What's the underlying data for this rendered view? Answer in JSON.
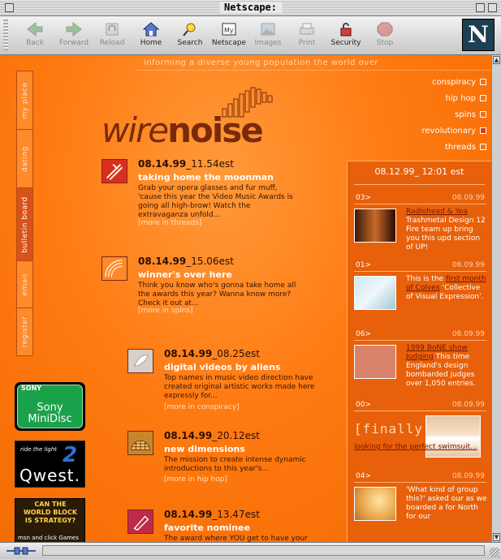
{
  "window": {
    "title": "Netscape:"
  },
  "toolbar": {
    "buttons": [
      {
        "label": "Back",
        "icon": "back-arrow-icon"
      },
      {
        "label": "Forward",
        "icon": "forward-arrow-icon"
      },
      {
        "label": "Reload",
        "icon": "reload-icon"
      },
      {
        "label": "Home",
        "icon": "home-icon"
      },
      {
        "label": "Search",
        "icon": "search-icon"
      },
      {
        "label": "Netscape",
        "icon": "netscape-my-icon"
      },
      {
        "label": "Images",
        "icon": "images-icon"
      },
      {
        "label": "Print",
        "icon": "print-icon"
      },
      {
        "label": "Security",
        "icon": "lock-icon"
      },
      {
        "label": "Stop",
        "icon": "stop-icon"
      }
    ],
    "logo": "N"
  },
  "page": {
    "tagline": "informing a diverse young population the world over",
    "logo": {
      "part1": "wire",
      "part2": "noise"
    },
    "nav": [
      "conspiracy",
      "hip hop",
      "spins",
      "revolutionary",
      "threads"
    ],
    "side_tabs": [
      "my place",
      "dating",
      "bulletin board",
      "email",
      "register"
    ],
    "stories": [
      {
        "date": "08.14.99",
        "time": "_11.54est",
        "headline": "taking home the moonman",
        "body": "Grab your opera glasses and fur muff, 'cause this year the Video Music Awards is going all high-brow! Watch the extravaganza unfold...",
        "more": "[more in threads]"
      },
      {
        "date": "08.14.99",
        "time": "_15.06est",
        "headline": "winner's over here",
        "body": "Think you know who's gonna take home all the awards this year? Wanna know more? Check it out at...",
        "more": "[more in spins]"
      },
      {
        "date": "08.14.99",
        "time": "_08.25est",
        "headline": "digital videos by aliens",
        "body": "Top names in music video direction have created original artistic works made here expressly for...",
        "more": "[more in conspiracy]"
      },
      {
        "date": "08.14.99",
        "time": "_20.12est",
        "headline": "new dimensions",
        "body": "The mission to create intense dynamic introductions to this year's...",
        "more": "[more in hip hop]"
      },
      {
        "date": "08.14.99",
        "time": "_13.47est",
        "headline": "favorite nominee",
        "body": "The award where YOU get to have your",
        "more": ""
      }
    ],
    "right_panel": {
      "date": "08.12.99_ 12:01 est",
      "items": [
        {
          "num": "03>",
          "date": "08.09.99",
          "link": "Radiohead & Yea",
          "text": "Trashmetal Design 12 Fire team up bring you this upd section of UP!"
        },
        {
          "num": "01>",
          "date": "08.09.99",
          "pre": "This is the ",
          "link": "first month of Colvex",
          "text": "'Collective of Visual Expression'."
        },
        {
          "num": "06>",
          "date": "08.09.99",
          "link": "1999 BoNE show Judging",
          "text": "This time England's design bombarded judges over 1,050 entries."
        },
        {
          "num": "00>",
          "date": "08.09.99",
          "finally": "[finally]",
          "link": "looking for the perfect swimsuit..."
        },
        {
          "num": "04>",
          "date": "08.09.99",
          "text": "'What kind of group this?' asked our as we boarded a for North for our"
        }
      ]
    },
    "ads": {
      "sony": {
        "brand": "SONY",
        "line1": "Sony",
        "line2": "MiniDisc"
      },
      "qwest": {
        "tag": "ride the light",
        "num": "2",
        "brand": "Qwest."
      },
      "msn": {
        "line1": "CAN THE",
        "line2": "WORLD BLOCK",
        "line3": "IS STRATEGY?",
        "brand": "msn",
        "tail": "and click Games"
      }
    }
  },
  "colors": {
    "page_orange": "#ff7a12",
    "panel_orange": "#e8600a",
    "dark_brown": "#7a2a0c",
    "link_red": "#7a1800"
  }
}
